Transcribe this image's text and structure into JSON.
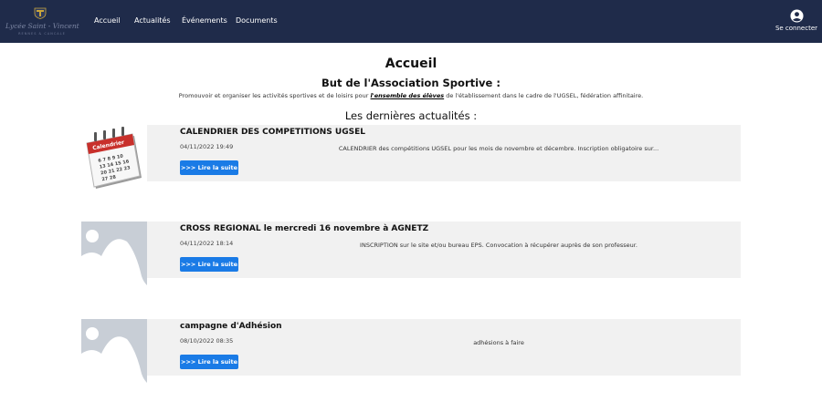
{
  "brand": {
    "name": "Lycée Saint - Vincent",
    "tagline": "RENNES & CANCALE"
  },
  "nav": {
    "items": [
      {
        "label": "Accueil"
      },
      {
        "label": "Actualités"
      },
      {
        "label": "Événements"
      },
      {
        "label": "Documents"
      }
    ],
    "login_label": "Se connecter"
  },
  "page": {
    "title": "Accueil",
    "goal_title": "But de l'Association Sportive :",
    "goal_text_before": "Promouvoir et organiser les activités sportives et de loisirs pour ",
    "goal_text_emphasis": "l'ensemble des élèves",
    "goal_text_after": " de l'établissement dans le cadre de l'UGSEL, fédération affinitaire.",
    "news_heading": "Les dernières actualités :"
  },
  "calendar_icon_text": "Calendrier",
  "news": [
    {
      "title": "CALENDRIER DES COMPETITIONS UGSEL",
      "date": "04/11/2022 19:49",
      "excerpt": "CALENDRIER des compétitions UGSEL pour les mois de novembre et décembre. Inscription obligatoire sur...",
      "button": ">>> Lire la suite",
      "thumb": "calendar-icon"
    },
    {
      "title": "CROSS REGIONAL le mercredi 16 novembre à AGNETZ",
      "date": "04/11/2022 18:14",
      "excerpt": "INSCRIPTION sur le site et/ou bureau EPS. Convocation à récupérer auprès de son professeur.",
      "button": ">>> Lire la suite",
      "thumb": "image-placeholder-icon"
    },
    {
      "title": "campagne d'Adhésion",
      "date": "08/10/2022 08:35",
      "excerpt": "adhésions à faire",
      "button": ">>> Lire la suite",
      "thumb": "image-placeholder-icon"
    }
  ],
  "colors": {
    "navbar": "#1f2b4a",
    "button": "#1a7be6",
    "card_bg": "#f1f1f1"
  }
}
